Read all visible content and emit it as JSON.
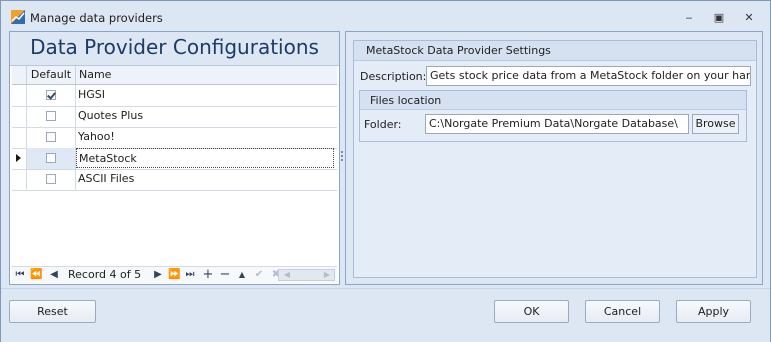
{
  "window": {
    "title": "Manage data providers",
    "minimize_glyph": "‒",
    "maximize_glyph": "▣",
    "close_glyph": "✕"
  },
  "left_panel": {
    "title": "Data Provider Configurations",
    "columns": {
      "default": "Default",
      "name": "Name"
    },
    "rows": [
      {
        "name": "HGSI",
        "default": true,
        "focused": false
      },
      {
        "name": "Quotes Plus",
        "default": false,
        "focused": false
      },
      {
        "name": "Yahoo!",
        "default": false,
        "focused": false
      },
      {
        "name": "MetaStock",
        "default": false,
        "focused": true
      },
      {
        "name": "ASCII Files",
        "default": false,
        "focused": false
      }
    ],
    "navigator": {
      "record_text": "Record 4 of 5",
      "buttons": {
        "first": "⏮",
        "prev_page": "⏪",
        "prev": "◀",
        "next": "▶",
        "next_page": "⏩",
        "last": "⏭",
        "append": "+",
        "delete": "−",
        "edit": "▲",
        "apply": "✔",
        "cancel": "✖"
      },
      "scroll_left": "◀",
      "scroll_right": "▶"
    }
  },
  "right_panel": {
    "group_title": "MetaStock Data Provider Settings",
    "description_label": "Description:",
    "description_value": "Gets stock price data from a MetaStock folder on your hard drive",
    "files_group_title": "Files location",
    "folder_label": "Folder:",
    "folder_value": "C:\\Norgate Premium Data\\Norgate Database\\",
    "browse_label": "Browse"
  },
  "footer": {
    "reset_label": "Reset",
    "ok_label": "OK",
    "cancel_label": "Cancel",
    "apply_label": "Apply"
  }
}
